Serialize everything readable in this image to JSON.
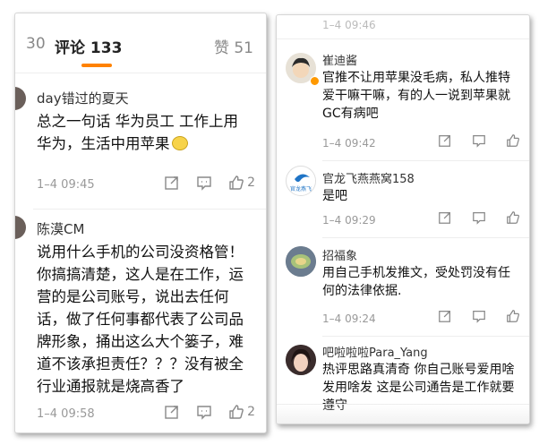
{
  "left_panel": {
    "tabs": {
      "reposts": "30",
      "comments": "评论 133",
      "likes": "赞 51"
    },
    "comments": [
      {
        "author": "day错过的夏天",
        "text": "总之一句话 华为员工 工作上用华为，生活中用苹果",
        "time": "1–4 09:45",
        "likes": "2"
      },
      {
        "author": "陈漠CM",
        "text": "说用什么手机的公司没资格管！你搞搞清楚，这人是在工作，运营的是公司账号，说出去任何话，做了任何事都代表了公司品牌形象，捅出这么大个篓子，难道不该承担责任？？？没有被全行业通报就是烧高香了",
        "time": "1–4 09:58",
        "likes": "2"
      }
    ]
  },
  "right_panel": {
    "top_time_partial": "1–4 09:46",
    "comments": [
      {
        "author": "崔迪酱",
        "text": "官推不让用苹果没毛病，私人推特爱干嘛干嘛，有的人一说到苹果就GC有病吧",
        "time": "1–4 09:42"
      },
      {
        "author": "官龙飞燕燕窝158",
        "avatar_text": "官龙燕飞",
        "text": "是吧",
        "time": "1–4 09:29"
      },
      {
        "author": "招福象",
        "text": "用自己手机发推文，受处罚没有任何的法律依据.",
        "time": "1–4 09:24"
      },
      {
        "author": "吧啦啦啦Para_Yang",
        "text": "热评思路真清奇 你自己账号爱用啥发用啥发 这是公司通告是工作就要遵守",
        "time": ""
      }
    ]
  },
  "icons": [
    "repost-icon",
    "comment-icon",
    "like-icon"
  ],
  "colors": {
    "accent": "#ff8200",
    "muted": "#999999",
    "vip": "#ff9900"
  }
}
